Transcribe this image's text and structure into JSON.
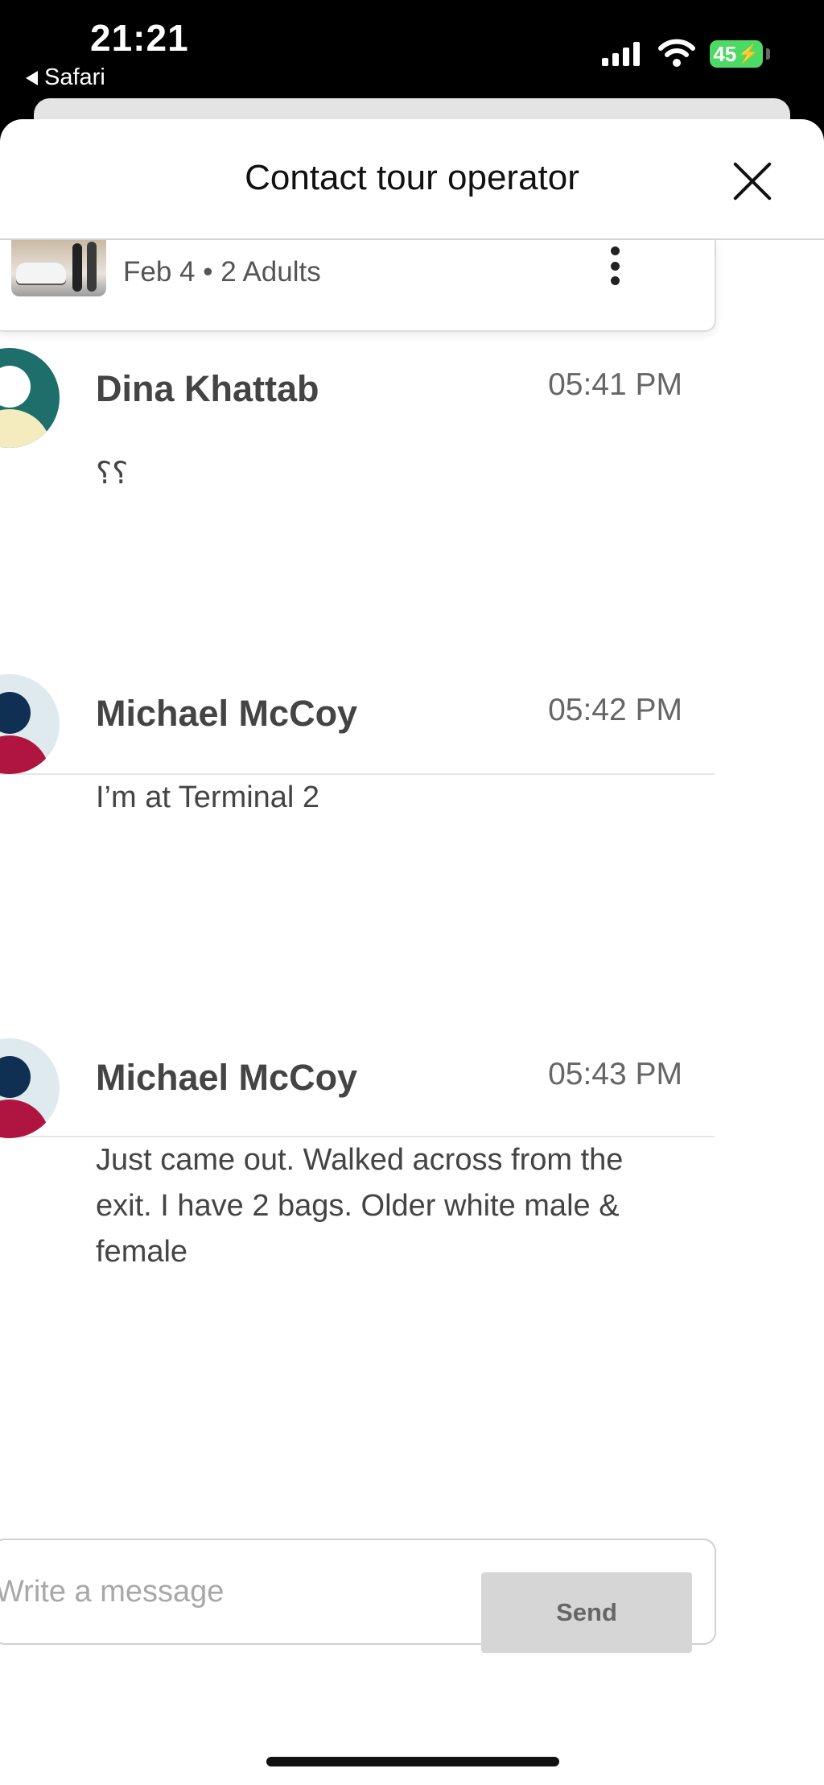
{
  "status_bar": {
    "time": "21:21",
    "back_app": "Safari",
    "battery": "45"
  },
  "sheet": {
    "title": "Contact tour operator",
    "booking": {
      "summary": "Feb 4 • 2 Adults"
    }
  },
  "messages": [
    {
      "sender": "Dina Khattab",
      "time": "05:41 PM",
      "text": "؟؟",
      "avatar_colors": [
        "#1e6e6c",
        "#f4ecbf",
        "#ffffff"
      ]
    },
    {
      "sender": "Michael McCoy",
      "time": "05:42 PM",
      "text": "I’m at Terminal 2",
      "avatar_colors": [
        "#dfeaee",
        "#b01540",
        "#0f3052"
      ]
    },
    {
      "sender": "Michael McCoy",
      "time": "05:43 PM",
      "text": "Just came out.  Walked across from the exit.  I have 2 bags.  Older white male & female",
      "avatar_colors": [
        "#dfeaee",
        "#b01540",
        "#0f3052"
      ]
    }
  ],
  "composer": {
    "placeholder": "Write a message",
    "send_label": "Send"
  }
}
